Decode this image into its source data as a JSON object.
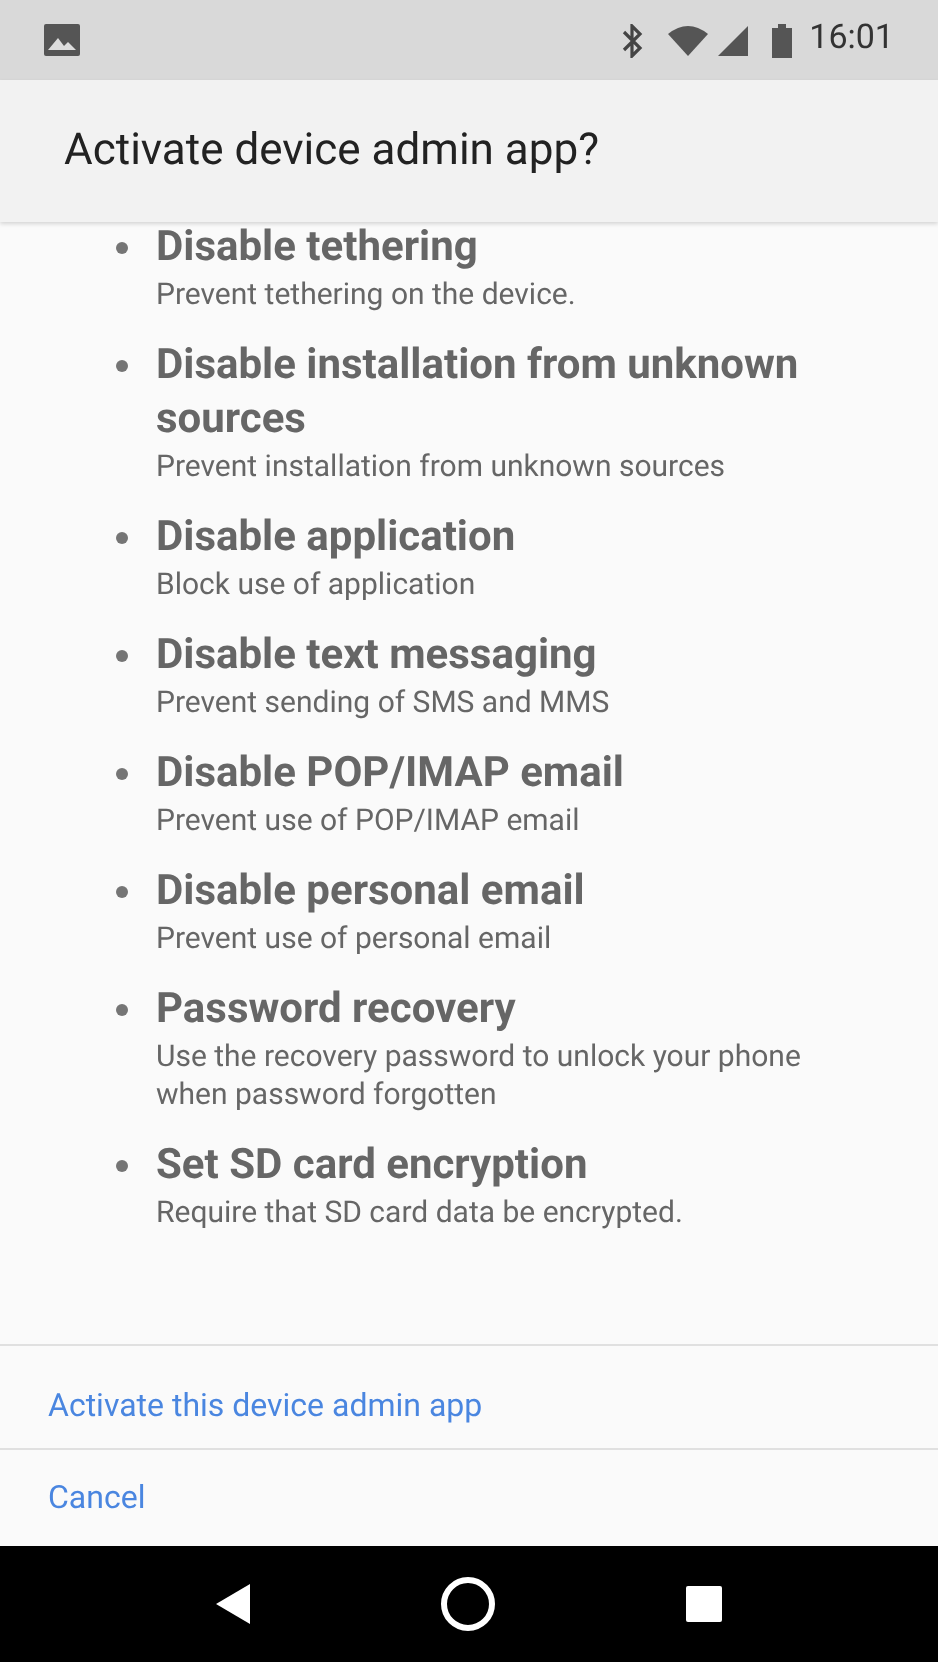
{
  "status_bar": {
    "time": "16:01"
  },
  "dialog": {
    "title": "Activate device admin app?",
    "policies": [
      {
        "title": "Disable tethering",
        "description": "Prevent tethering on the device."
      },
      {
        "title": "Disable installation from unknown sources",
        "description": "Prevent installation from unknown sources"
      },
      {
        "title": "Disable application",
        "description": "Block use of application"
      },
      {
        "title": "Disable text messaging",
        "description": "Prevent sending of SMS and MMS"
      },
      {
        "title": "Disable POP/IMAP email",
        "description": "Prevent use of POP/IMAP email"
      },
      {
        "title": "Disable personal email",
        "description": "Prevent use of personal email"
      },
      {
        "title": "Password recovery",
        "description": "Use the recovery password to unlock your phone when password forgotten"
      },
      {
        "title": "Set SD card encryption",
        "description": "Require that SD card data be encrypted."
      }
    ],
    "actions": [
      "Activate this device admin app",
      "Cancel"
    ]
  }
}
